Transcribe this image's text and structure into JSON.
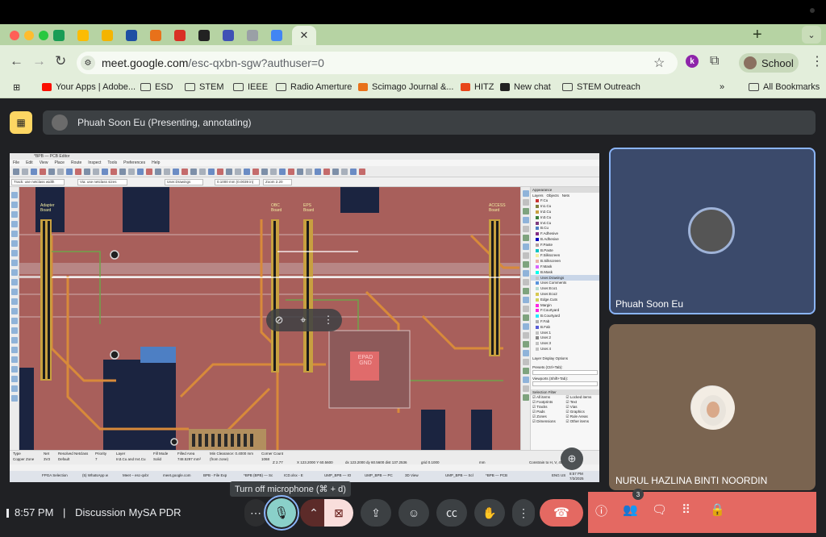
{
  "browser": {
    "tabs": [
      {
        "icon": "meet-tab-icon",
        "color": "#1a9c55"
      },
      {
        "icon": "drive-tab-icon",
        "color": "#fbbc04"
      },
      {
        "icon": "slides-tab-icon",
        "color": "#f4b400"
      },
      {
        "icon": "m-tab-icon",
        "color": "#1e4fa3"
      },
      {
        "icon": "sc-tab-icon",
        "color": "#e8711a"
      },
      {
        "icon": "gmail-tab-icon",
        "color": "#d93025"
      },
      {
        "icon": "wix-tab-icon",
        "color": "#222222"
      },
      {
        "icon": "forms-tab-icon",
        "color": "#3f51b5"
      },
      {
        "icon": "gray-tab-icon",
        "color": "#9aa0a6"
      },
      {
        "icon": "calendar-tab-icon",
        "color": "#4285f4"
      }
    ],
    "active_tab_close": "✕",
    "url_host": "meet.google.com",
    "url_path": "/esc-qxbn-sgw?authuser=0",
    "profile_label": "School",
    "extension_badge": "k",
    "bookmarks": [
      {
        "label": "Your Apps | Adobe...",
        "icon": "adobe-icon"
      },
      {
        "label": "ESD",
        "icon": "folder-icon"
      },
      {
        "label": "STEM",
        "icon": "folder-icon"
      },
      {
        "label": "IEEE",
        "icon": "folder-icon"
      },
      {
        "label": "Radio Amerture",
        "icon": "folder-icon"
      },
      {
        "label": "Scimago Journal &...",
        "icon": "sjr-icon"
      },
      {
        "label": "HITZ",
        "icon": "hitz-icon"
      },
      {
        "label": "New chat",
        "icon": "openai-icon"
      },
      {
        "label": "STEM Outreach",
        "icon": "folder-icon"
      }
    ],
    "bookmarks_more": "»",
    "all_bookmarks": "All Bookmarks"
  },
  "meet": {
    "presenter_banner": "Phuah Soon Eu (Presenting, annotating)",
    "participants": [
      {
        "name": "Phuah Soon Eu"
      },
      {
        "name": "NURUL HAZLINA BINTI NOORDIN"
      }
    ],
    "time": "8:57 PM",
    "separator": "|",
    "meeting_name": "Discussion MySA PDR",
    "tooltip": "Turn off microphone (⌘ + d)",
    "participant_count": "3",
    "accent_colors": {
      "end_call": "#e46962",
      "mic": "#8ad0c9",
      "presenting": "#fdd663"
    }
  },
  "kicad": {
    "window_title": "*BPB — PCB Editor",
    "menu": [
      "File",
      "Edit",
      "View",
      "Place",
      "Route",
      "Inspect",
      "Tools",
      "Preferences",
      "Help"
    ],
    "track_width": "Track: use netclass width",
    "via_size": "Via: use netclass sizes",
    "active_layer": "User.Drawings",
    "grid": "0.1000 mm (0.0039 in)",
    "zoom": "Zoom 2.20",
    "panel_title": "Appearance",
    "panel_tabs": [
      "Layers",
      "Objects",
      "Nets"
    ],
    "layers": [
      {
        "name": "F.Cu",
        "color": "#c83434"
      },
      {
        "name": "In1.Cu",
        "color": "#7f7f3f"
      },
      {
        "name": "In2.Cu",
        "color": "#c8a040"
      },
      {
        "name": "In3.Cu",
        "color": "#3c7f3c"
      },
      {
        "name": "In4.Cu",
        "color": "#7f3c7f"
      },
      {
        "name": "B.Cu",
        "color": "#4d7fc4"
      },
      {
        "name": "F.Adhesive",
        "color": "#842e84"
      },
      {
        "name": "B.Adhesive",
        "color": "#0000c0"
      },
      {
        "name": "F.Paste",
        "color": "#b4a0a0"
      },
      {
        "name": "B.Paste",
        "color": "#00c2c2"
      },
      {
        "name": "F.Silkscreen",
        "color": "#f2eda1"
      },
      {
        "name": "B.Silkscreen",
        "color": "#e8b2a7"
      },
      {
        "name": "F.Mask",
        "color": "#d864ff"
      },
      {
        "name": "B.Mask",
        "color": "#02ffee"
      },
      {
        "name": "User.Drawings",
        "color": "#c2c2c2"
      },
      {
        "name": "User.Comments",
        "color": "#5994dc"
      },
      {
        "name": "User.Eco1",
        "color": "#b4db d2"
      },
      {
        "name": "User.Eco2",
        "color": "#d8c852"
      },
      {
        "name": "Edge.Cuts",
        "color": "#d0d25c"
      },
      {
        "name": "Margin",
        "color": "#ff26e2"
      },
      {
        "name": "F.Courtyard",
        "color": "#ff26e2"
      },
      {
        "name": "B.Courtyard",
        "color": "#26e9ff"
      },
      {
        "name": "F.Fab",
        "color": "#afafaf"
      },
      {
        "name": "B.Fab",
        "color": "#585dd7"
      },
      {
        "name": "User.1",
        "color": "#c2c2c2"
      },
      {
        "name": "User.2",
        "color": "#898989"
      },
      {
        "name": "User.3",
        "color": "#c2c2c2"
      },
      {
        "name": "User.4",
        "color": "#c2c2c2"
      }
    ],
    "layer_display_options": "Layer Display Options",
    "presets_label": "Presets (Ctrl+Tab):",
    "viewports_label": "Viewports (Shift+Tab):",
    "selection_filter_title": "Selection Filter",
    "selection_filter": [
      "All items",
      "Locked items",
      "Footprints",
      "Text",
      "Tracks",
      "Vias",
      "Pads",
      "Graphics",
      "Zones",
      "Rule Areas",
      "Dimensions",
      "Other items"
    ],
    "board_labels": [
      "Adapter Board",
      "OBC Board",
      "EPS Board",
      "ACCESS Board"
    ],
    "chip_label": "EPAD GND",
    "status": {
      "type_label": "Type",
      "type_value": "Copper Zone",
      "net_label": "Net",
      "net_value": "3V3",
      "netclass_label": "Resolved Netclass",
      "netclass_value": "Default",
      "priority_label": "Priority",
      "priority_value": "7",
      "layer_label": "Layer",
      "layer_value": "In3.Cu and In4.Cu",
      "fill_label": "Fill Mode",
      "fill_value": "Solid",
      "area_label": "Filled Area",
      "area_value": "748.5297 mm²",
      "clearance_label": "Min Clearance: 0.4000 mm",
      "clearance_value": "(from zone)",
      "corner_label": "Corner Count",
      "corner_value": "1068",
      "zoom_readout": "Z 2.77",
      "xy_readout": "X 123.2000  Y 60.5600",
      "delta_readout": "dx 123.2000  dy 60.5600  dist 137.2536",
      "grid_readout": "grid 0.1000",
      "units": "mm",
      "constrain": "Constrain to H, V, 45"
    },
    "taskbar": [
      "FPGA Selection",
      "(5) WhatsApp w",
      "Meet – esc-qxbr",
      "meet.google.com",
      "BPB - File Exp",
      "*BPB (BPB) — Sc",
      "ICD.xlsx - E",
      "UMP_BPB — IO",
      "UMP_BPB — PC",
      "3D View",
      "UMP_BPB — Scl",
      "*BPB — PCB"
    ],
    "taskbar_lang": "ENG US",
    "taskbar_time": "8:57 PM",
    "taskbar_date": "7/3/2025"
  }
}
